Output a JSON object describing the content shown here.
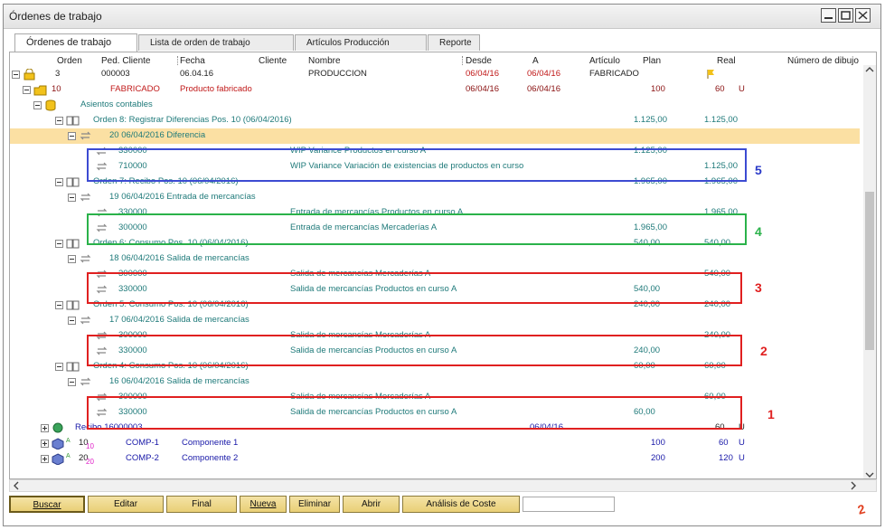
{
  "window": {
    "title": "Órdenes de trabajo"
  },
  "tabs": [
    "Órdenes de trabajo",
    "Lista de orden de trabajo",
    "Artículos Producción",
    "Reporte"
  ],
  "columns": [
    "Orden",
    "Ped. Cliente",
    "Fecha",
    "Cliente",
    "Nombre",
    "Desde",
    "A",
    "Artículo",
    "Plan",
    "Real",
    "Número de dibujo"
  ],
  "root": {
    "orden": "3",
    "ped": "000003",
    "fecha": "06.04.16",
    "nombre": "PRODUCCION",
    "desde": "06/04/16",
    "a": "06/04/16",
    "articulo": "FABRICADO"
  },
  "sub": {
    "orden": "10",
    "ped": "FABRICADO",
    "fecha": "Producto fabricado",
    "desde": "06/04/16",
    "a": "06/04/16",
    "plan": "100",
    "real": "60",
    "unit": "U"
  },
  "asientos": "Asientos contables",
  "rows": [
    {
      "label": "Orden 8: Registrar Diferencias Pos. 10   (06/04/2016)",
      "plan": "1.125,00",
      "real": "1.125,00"
    },
    {
      "label": "20 06/04/2016 Diferencia"
    },
    {
      "code": "330000",
      "desc": "WIP Variance  Productos en curso A",
      "plan": "1.125,00",
      "real": ""
    },
    {
      "code": "710000",
      "desc": "WIP Variance  Variación de existencias de productos en curso",
      "plan": "",
      "real": "1.125,00"
    },
    {
      "label": "Orden 7: Recibo Pos. 10   (06/04/2016)",
      "plan": "1.965,00",
      "real": "1.965,00"
    },
    {
      "label": "19 06/04/2016 Entrada de mercancías"
    },
    {
      "code": "330000",
      "desc": "Entrada de mercancías  Productos en curso A",
      "plan": "",
      "real": "1.965,00"
    },
    {
      "code": "300000",
      "desc": "Entrada de mercancías  Mercaderías A",
      "plan": "1.965,00",
      "real": ""
    },
    {
      "label": "Orden 6: Consumo Pos. 10   (06/04/2016)",
      "plan": "540,00",
      "real": "540,00"
    },
    {
      "label": "18 06/04/2016 Salida de mercancías"
    },
    {
      "code": "300000",
      "desc": "Salida de mercancías  Mercaderías A",
      "plan": "",
      "real": "540,00"
    },
    {
      "code": "330000",
      "desc": "Salida de mercancías  Productos en curso A",
      "plan": "540,00",
      "real": ""
    },
    {
      "label": "Orden 5: Consumo Pos. 10   (06/04/2016)",
      "plan": "240,00",
      "real": "240,00"
    },
    {
      "label": "17 06/04/2016 Salida de mercancías"
    },
    {
      "code": "300000",
      "desc": "Salida de mercancías  Mercaderías A",
      "plan": "",
      "real": "240,00"
    },
    {
      "code": "330000",
      "desc": "Salida de mercancías  Productos en curso A",
      "plan": "240,00",
      "real": ""
    },
    {
      "label": "Orden 4: Consumo Pos. 10   (06/04/2016)",
      "plan": "60,00",
      "real": "60,00"
    },
    {
      "label": "16 06/04/2016 Salida de mercancías"
    },
    {
      "code": "300000",
      "desc": "Salida de mercancías  Mercaderías A",
      "plan": "",
      "real": "60,00"
    },
    {
      "code": "330000",
      "desc": "Salida de mercancías  Productos en curso A",
      "plan": "60,00",
      "real": ""
    }
  ],
  "recibo": {
    "label": "Recibo 16000003",
    "desde": "06/04/16",
    "real": "60",
    "unit": "U"
  },
  "comps": [
    {
      "orden": "10",
      "sub": "10",
      "ped": "COMP-1",
      "fecha": "Componente 1",
      "plan": "100",
      "real": "60",
      "unit": "U"
    },
    {
      "orden": "20",
      "sub": "20",
      "ped": "COMP-2",
      "fecha": "Componente 2",
      "plan": "200",
      "real": "120",
      "unit": "U"
    }
  ],
  "annotations": [
    "5",
    "4",
    "3",
    "2",
    "1"
  ],
  "corner_mark": "2",
  "buttons": [
    "Buscar",
    "Editar",
    "Final",
    "Nueva",
    "Eliminar",
    "Abrir",
    "Análisis de Coste"
  ],
  "search": {
    "value": ""
  },
  "colors": {
    "highlight": "#fbe0a3",
    "blue_box": "#3c4bd2",
    "green_box": "#2ab24a",
    "red_box": "#e02020",
    "button": "#ecd58a"
  }
}
